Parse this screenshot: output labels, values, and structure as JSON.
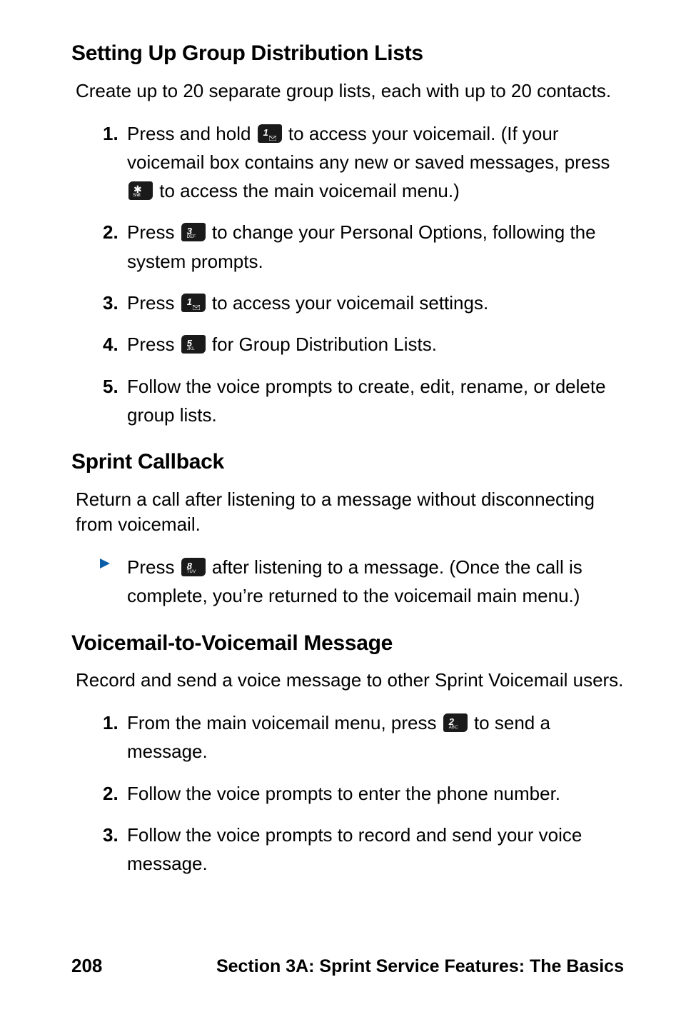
{
  "sections": {
    "group_lists": {
      "heading": "Setting Up Group Distribution Lists",
      "intro": "Create up to 20 separate group lists, each with up to 20 contacts.",
      "steps": {
        "1": {
          "num": "1.",
          "a": "Press and hold ",
          "b": " to access your voicemail. (If your voicemail box contains any new or saved messages, press ",
          "c": " to access the main voicemail menu.)"
        },
        "2": {
          "num": "2.",
          "a": "Press ",
          "b": " to change your Personal Options, following the system prompts."
        },
        "3": {
          "num": "3.",
          "a": "Press ",
          "b": " to access your voicemail settings."
        },
        "4": {
          "num": "4.",
          "a": "Press ",
          "b": " for Group Distribution Lists."
        },
        "5": {
          "num": "5.",
          "a": "Follow the voice prompts to create, edit, rename, or delete group lists."
        }
      }
    },
    "sprint_callback": {
      "heading": "Sprint Callback",
      "intro": "Return a call after listening to a message without disconnecting from voicemail.",
      "bullet": {
        "a": "Press ",
        "b": " after listening to a message. (Once the call is complete, you’re returned to the voicemail main menu.)"
      }
    },
    "vm_to_vm": {
      "heading": "Voicemail-to-Voicemail Message",
      "intro": "Record and send a voice message to other Sprint Voicemail users.",
      "steps": {
        "1": {
          "num": "1.",
          "a": "From the main voicemail menu, press ",
          "b": " to send a message"
        },
        "2": {
          "num": "2.",
          "a": "Follow the voice prompts to enter the phone number."
        },
        "3": {
          "num": "3.",
          "a": "Follow the voice prompts to record and send your voice message."
        }
      }
    }
  },
  "keys": {
    "1": {
      "main": "1",
      "sub": ""
    },
    "2": {
      "main": "2",
      "sub": "ABC"
    },
    "3": {
      "main": "3",
      "sub": "DEF"
    },
    "5": {
      "main": "5",
      "sub": "JKL"
    },
    "8": {
      "main": "8",
      "sub": "TUV"
    }
  },
  "footer": {
    "page": "208",
    "section": "Section 3A: Sprint Service Features: The Basics"
  },
  "period": "."
}
